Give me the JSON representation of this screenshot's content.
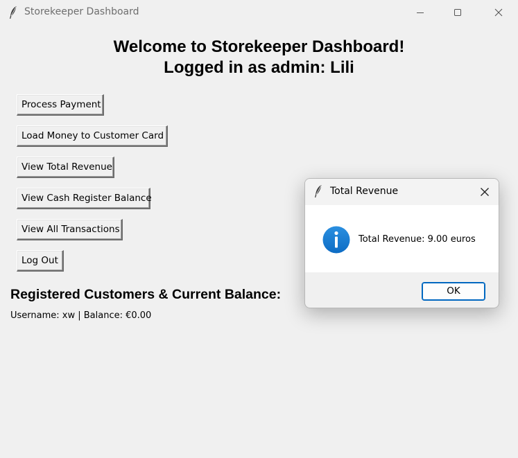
{
  "window": {
    "title": "Storekeeper Dashboard"
  },
  "header": {
    "welcome": "Welcome to Storekeeper Dashboard!",
    "logged_in": "Logged in as admin: Lili"
  },
  "actions": {
    "process_payment": "Process Payment",
    "load_money": "Load Money to Customer Card",
    "view_total_revenue": "View Total Revenue",
    "view_cash_register_balance": "View Cash Register Balance",
    "view_all_transactions": "View All Transactions",
    "log_out": "Log Out"
  },
  "customers": {
    "section_title": "Registered Customers & Current Balance:",
    "entries": [
      "Username: xw | Balance: €0.00"
    ]
  },
  "dialog": {
    "title": "Total Revenue",
    "message": "Total Revenue: 9.00 euros",
    "ok_label": "OK",
    "icon": "info-icon"
  },
  "colors": {
    "accent": "#0067c0",
    "info_icon": "#1a7fd4"
  }
}
